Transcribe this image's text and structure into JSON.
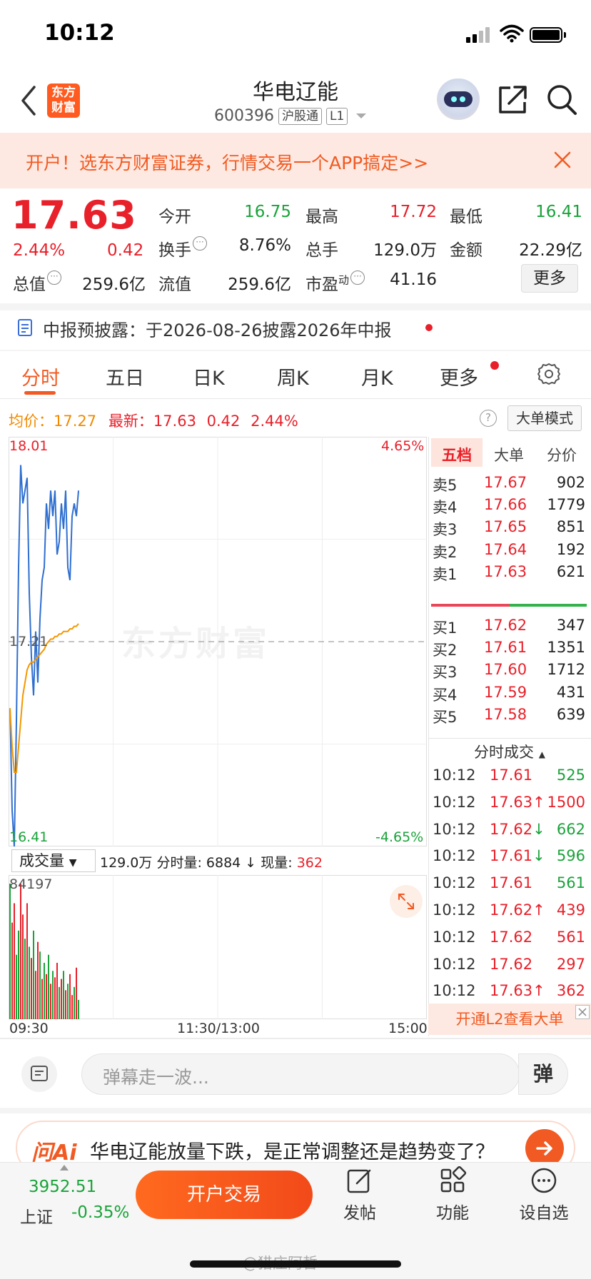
{
  "status_bar": {
    "time": "10:12"
  },
  "header": {
    "logo_text": "东方财富",
    "title": "华电辽能",
    "code": "600396",
    "tag1": "沪股通",
    "tag2": "L1"
  },
  "banner": {
    "text": "开户！选东方财富证券，行情交易一个APP搞定>>"
  },
  "quote": {
    "price": "17.63",
    "pct": "2.44%",
    "change": "0.42",
    "rows": [
      [
        {
          "label": "今开",
          "value": "16.75",
          "color": "green"
        },
        {
          "label": "最高",
          "value": "17.72",
          "color": "red"
        },
        {
          "label": "最低",
          "value": "16.41",
          "color": "green"
        }
      ],
      [
        {
          "label": "换手",
          "value": "8.76%",
          "color": "black"
        },
        {
          "label": "总手",
          "value": "129.0万",
          "color": "black"
        },
        {
          "label": "金额",
          "value": "22.29亿",
          "color": "black"
        }
      ],
      [
        {
          "label": "总值",
          "value": "259.6亿",
          "color": "black"
        },
        {
          "label": "流值",
          "value": "259.6亿",
          "color": "black"
        },
        {
          "label": "市盈",
          "value": "41.16",
          "color": "black"
        }
      ]
    ],
    "pe_sup": "动",
    "more_label": "更多"
  },
  "notice": {
    "text": "中报预披露：于2026-08-26披露2026年中报"
  },
  "tabs": [
    "分时",
    "五日",
    "日K",
    "周K",
    "月K",
    "更多"
  ],
  "avg_line": {
    "avg_label": "均价：",
    "avg_value": "17.27",
    "latest_label": "最新：",
    "latest_value": "17.63",
    "latest_change": "0.42",
    "latest_pct": "2.44%",
    "help": "?",
    "big_mode": "大单模式"
  },
  "chart_data": {
    "type": "line",
    "y_top": "18.01",
    "y_mid": "17.21",
    "y_bottom": "16.41",
    "pct_top": "4.65%",
    "pct_bottom": "-4.65%",
    "ylim": [
      16.41,
      18.01
    ],
    "series": [],
    "price": [
      16.95,
      16.55,
      16.41,
      16.9,
      17.5,
      17.9,
      17.75,
      17.8,
      17.85,
      17.4,
      17.15,
      17.0,
      17.25,
      17.05,
      17.3,
      17.45,
      17.5,
      17.75,
      17.65,
      17.8,
      17.7,
      17.8,
      17.55,
      17.6,
      17.75,
      17.65,
      17.8,
      17.5,
      17.45,
      17.7,
      17.75,
      17.7,
      17.8
    ],
    "avg": [
      16.95,
      16.8,
      16.7,
      16.7,
      16.8,
      16.9,
      17.0,
      17.05,
      17.1,
      17.12,
      17.13,
      17.13,
      17.14,
      17.15,
      17.16,
      17.17,
      17.18,
      17.2,
      17.21,
      17.22,
      17.22,
      17.23,
      17.23,
      17.24,
      17.24,
      17.25,
      17.25,
      17.25,
      17.26,
      17.26,
      17.27,
      17.27,
      17.28
    ],
    "volume": [
      84197,
      60000,
      72000,
      40000,
      55000,
      84197,
      65000,
      50000,
      72000,
      45000,
      38000,
      55000,
      30000,
      48000,
      42000,
      25000,
      35000,
      28000,
      40000,
      22000,
      30000,
      26000,
      35000,
      20000,
      25000,
      30000,
      18000,
      22000,
      28000,
      15000,
      20000,
      32000,
      12000
    ],
    "volume_dir": [
      0,
      1,
      1,
      0,
      0,
      1,
      1,
      0,
      1,
      0,
      1,
      0,
      1,
      1,
      0,
      1,
      0,
      1,
      0,
      1,
      0,
      1,
      1,
      0,
      1,
      0,
      1,
      0,
      1,
      1,
      0,
      1,
      0
    ],
    "vol_max_label": "84197",
    "x_ticks": [
      "09:30",
      "11:30/13:00",
      "15:00"
    ]
  },
  "volume_bar": {
    "select": "成交量",
    "total": "129.0万",
    "minute_label": "分时量:",
    "minute_value": "6884",
    "now_label": "现量:",
    "now_value": "362"
  },
  "order_book": {
    "tabs": [
      "五档",
      "大单",
      "分价"
    ],
    "asks": [
      {
        "label": "卖5",
        "price": "17.67",
        "vol": "902"
      },
      {
        "label": "卖4",
        "price": "17.66",
        "vol": "1779"
      },
      {
        "label": "卖3",
        "price": "17.65",
        "vol": "851"
      },
      {
        "label": "卖2",
        "price": "17.64",
        "vol": "192"
      },
      {
        "label": "卖1",
        "price": "17.63",
        "vol": "621"
      }
    ],
    "bids": [
      {
        "label": "买1",
        "price": "17.62",
        "vol": "347"
      },
      {
        "label": "买2",
        "price": "17.61",
        "vol": "1351"
      },
      {
        "label": "买3",
        "price": "17.60",
        "vol": "1712"
      },
      {
        "label": "买4",
        "price": "17.59",
        "vol": "431"
      },
      {
        "label": "买5",
        "price": "17.58",
        "vol": "639"
      }
    ],
    "ticks_header": "分时成交",
    "ticks": [
      {
        "time": "10:12",
        "price": "17.61",
        "arrow": "",
        "vol": "525",
        "color": "green"
      },
      {
        "time": "10:12",
        "price": "17.63",
        "arrow": "↑",
        "vol": "1500",
        "color": "red"
      },
      {
        "time": "10:12",
        "price": "17.62",
        "arrow": "↓",
        "vol": "662",
        "color": "green"
      },
      {
        "time": "10:12",
        "price": "17.61",
        "arrow": "↓",
        "vol": "596",
        "color": "green"
      },
      {
        "time": "10:12",
        "price": "17.61",
        "arrow": "",
        "vol": "561",
        "color": "green"
      },
      {
        "time": "10:12",
        "price": "17.62",
        "arrow": "↑",
        "vol": "439",
        "color": "red"
      },
      {
        "time": "10:12",
        "price": "17.62",
        "arrow": "",
        "vol": "561",
        "color": "red"
      },
      {
        "time": "10:12",
        "price": "17.62",
        "arrow": "",
        "vol": "297",
        "color": "red"
      },
      {
        "time": "10:12",
        "price": "17.63",
        "arrow": "↑",
        "vol": "362",
        "color": "red"
      }
    ],
    "l2_text": "开通L2查看大单"
  },
  "comment": {
    "placeholder": "弹幕走一波...",
    "button": "弹"
  },
  "ai": {
    "logo": "问Ai",
    "text": "华电辽能放量下跌，是正常调整还是趋势变了？"
  },
  "bottom": {
    "index_value": "3952.51",
    "index_name": "上证",
    "index_change": "-0.35%",
    "trade": "开户交易",
    "nav": [
      "发帖",
      "功能",
      "设自选"
    ]
  },
  "watermark": {
    "chart": "东方财富",
    "footer": "@猎庄阿哲"
  }
}
